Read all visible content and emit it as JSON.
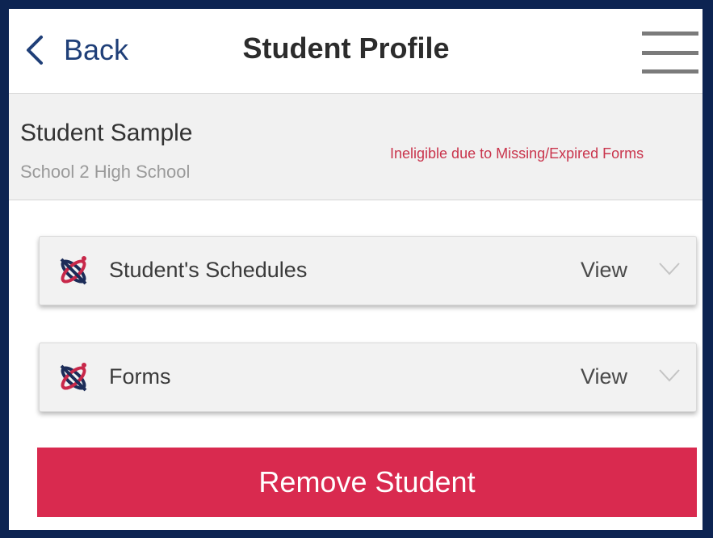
{
  "header": {
    "back_label": "Back",
    "title": "Student Profile",
    "back_icon": "chevron-left-icon",
    "menu_icon": "hamburger-menu-icon"
  },
  "student": {
    "name": "Student Sample",
    "school": "School 2 High School",
    "status": "Ineligible due to Missing/Expired Forms"
  },
  "sections": [
    {
      "label": "Student's Schedules",
      "action": "View",
      "icon": "app-logo-icon",
      "chevron": "chevron-down-icon"
    },
    {
      "label": "Forms",
      "action": "View",
      "icon": "app-logo-icon",
      "chevron": "chevron-down-icon"
    }
  ],
  "remove_button": {
    "label": "Remove Student"
  },
  "colors": {
    "frame_border": "#0d2452",
    "accent_blue": "#1f3f78",
    "status_red": "#c9344c",
    "remove_button": "#d92a4f",
    "info_background": "#f1f1f1",
    "panel_background": "#f2f2f2"
  }
}
